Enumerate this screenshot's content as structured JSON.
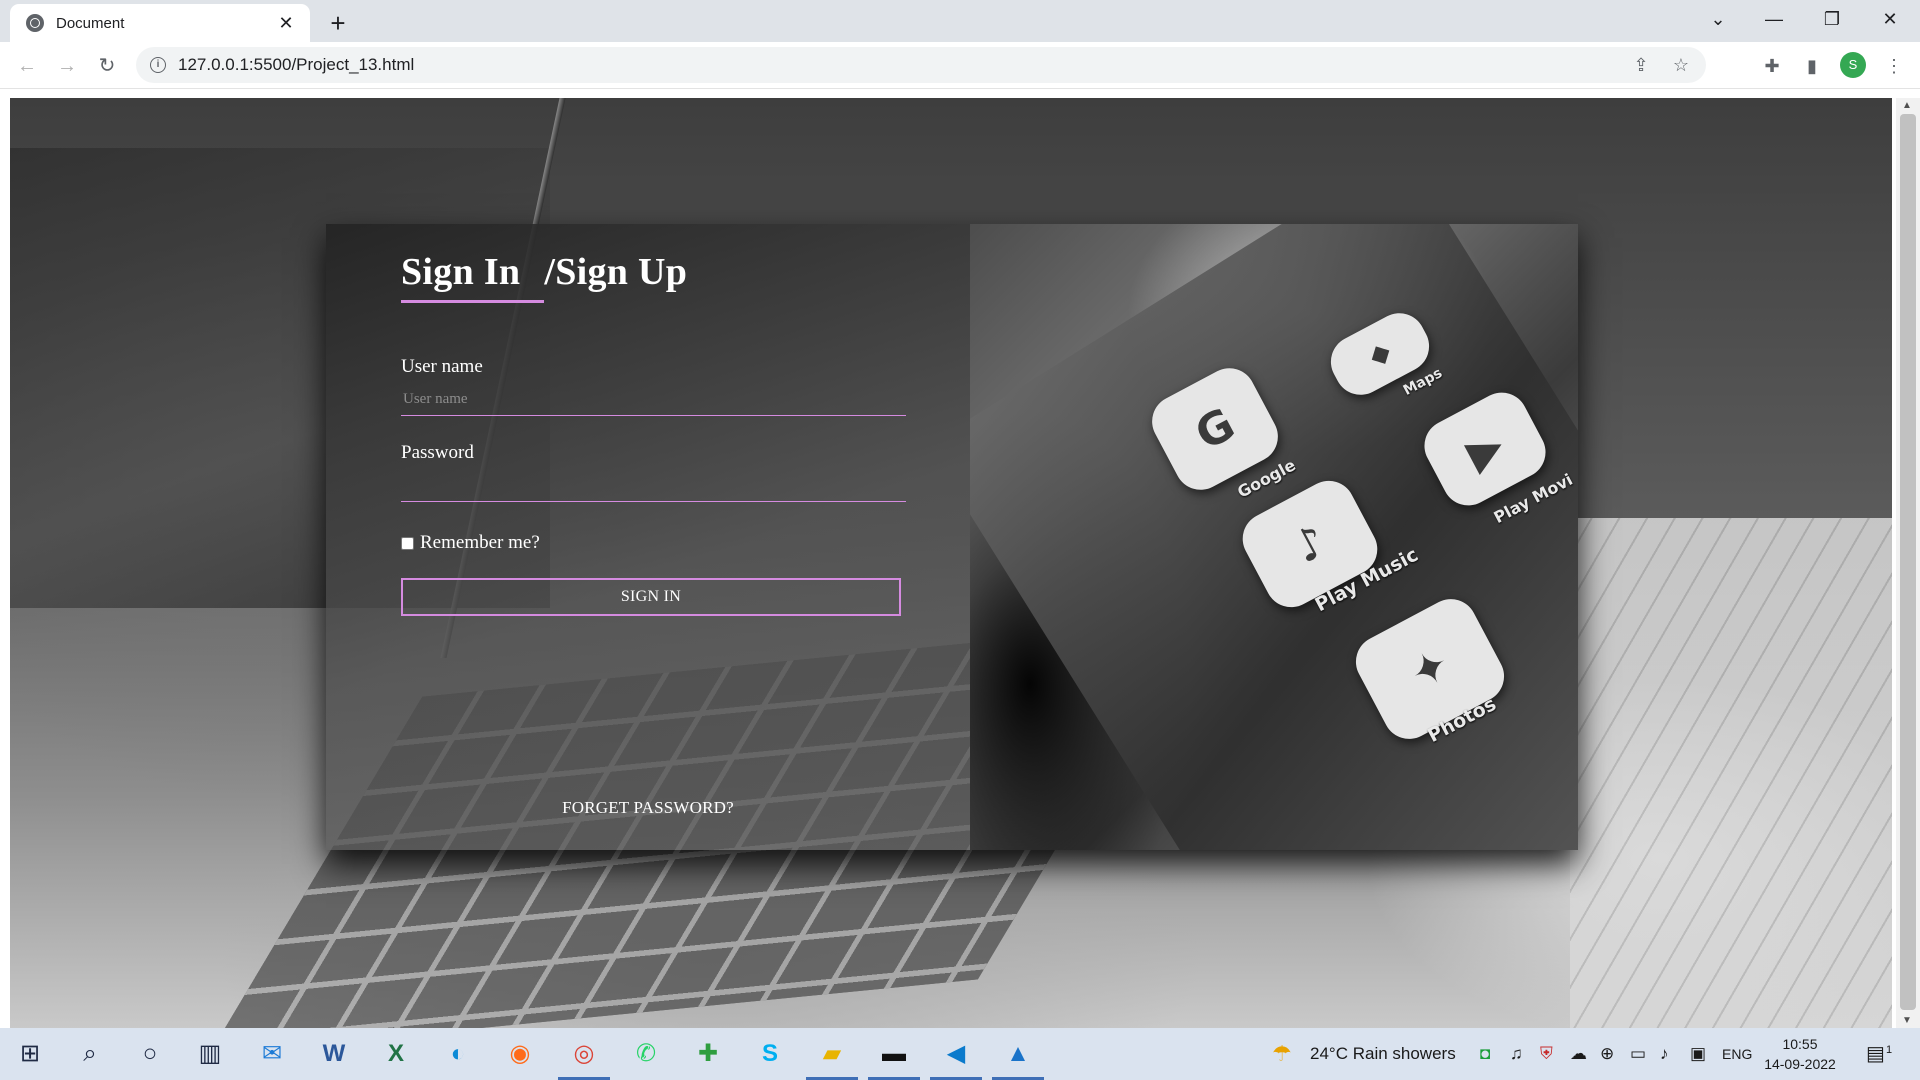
{
  "browser": {
    "tab_title": "Document",
    "url": "127.0.0.1:5500/Project_13.html",
    "profile_initial": "S"
  },
  "form": {
    "heading_signin": "Sign In",
    "heading_signup": "/Sign Up",
    "username_label": "User name",
    "username_placeholder": "User name",
    "password_label": "Password",
    "remember_label": "Remember me?",
    "signin_button": "SIGN IN",
    "forget_link": "FORGET PASSWORD?",
    "accent_color": "#d58be0"
  },
  "photo_apps": [
    {
      "name": "Google",
      "glyph": "G"
    },
    {
      "name": "Maps",
      "glyph": "◆"
    },
    {
      "name": "Play Movi",
      "glyph": "▶"
    },
    {
      "name": "Play Music",
      "glyph": "♪"
    },
    {
      "name": "Photos",
      "glyph": "✦"
    }
  ],
  "taskbar": {
    "weather": "24°C  Rain showers",
    "language": "ENG",
    "time": "10:55",
    "date": "14-09-2022",
    "notifications": "1"
  }
}
